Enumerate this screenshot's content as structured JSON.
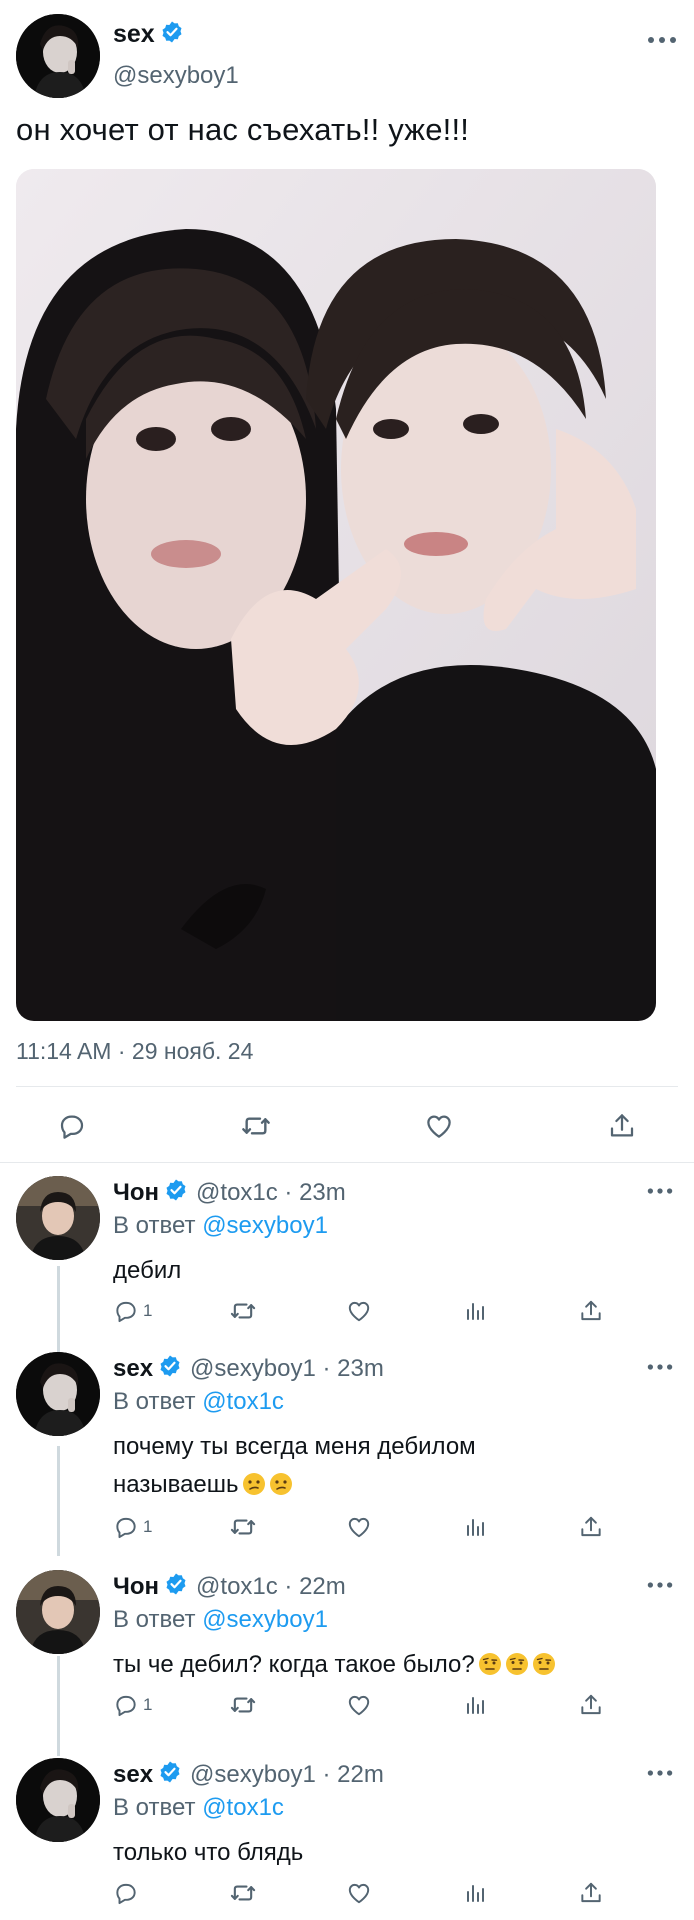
{
  "main_tweet": {
    "author_name": "sex",
    "author_handle": "@sexyboy1",
    "text": "он хочет от нас съехать!! уже!!!",
    "timestamp": "11:14 AM · 29 нояб. 24",
    "icons": [
      "reply-icon",
      "retweet-icon",
      "like-icon",
      "share-icon"
    ]
  },
  "replies": [
    {
      "author_name": "Чон",
      "meta": "@tox1c · 23m",
      "reply_to_label": "В ответ",
      "reply_to_handle": "@sexyboy1",
      "text": "дебил",
      "emojis": 0,
      "reply_count": "1"
    },
    {
      "author_name": "sex",
      "meta": "@sexyboy1 · 23m",
      "reply_to_label": "В ответ",
      "reply_to_handle": "@tox1c",
      "text": "почему ты всегда меня дебилом называешь",
      "emojis": 2,
      "emoji_kind": "confused-face-emoji",
      "reply_count": "1"
    },
    {
      "author_name": "Чон",
      "meta": "@tox1c · 22m",
      "reply_to_label": "В ответ",
      "reply_to_handle": "@sexyboy1",
      "text": "ты че дебил? когда такое было?",
      "emojis": 3,
      "emoji_kind": "raised-eyebrow-emoji",
      "reply_count": "1"
    },
    {
      "author_name": "sex",
      "meta": "@sexyboy1 · 22m",
      "reply_to_label": "В ответ",
      "reply_to_handle": "@tox1c",
      "text": "только что блядь",
      "emojis": 0,
      "reply_count": ""
    }
  ],
  "colors": {
    "link": "#1d9bf0",
    "verified": "#1d9bf0",
    "secondary_text": "#536471",
    "thread_line": "#cfd9de"
  }
}
